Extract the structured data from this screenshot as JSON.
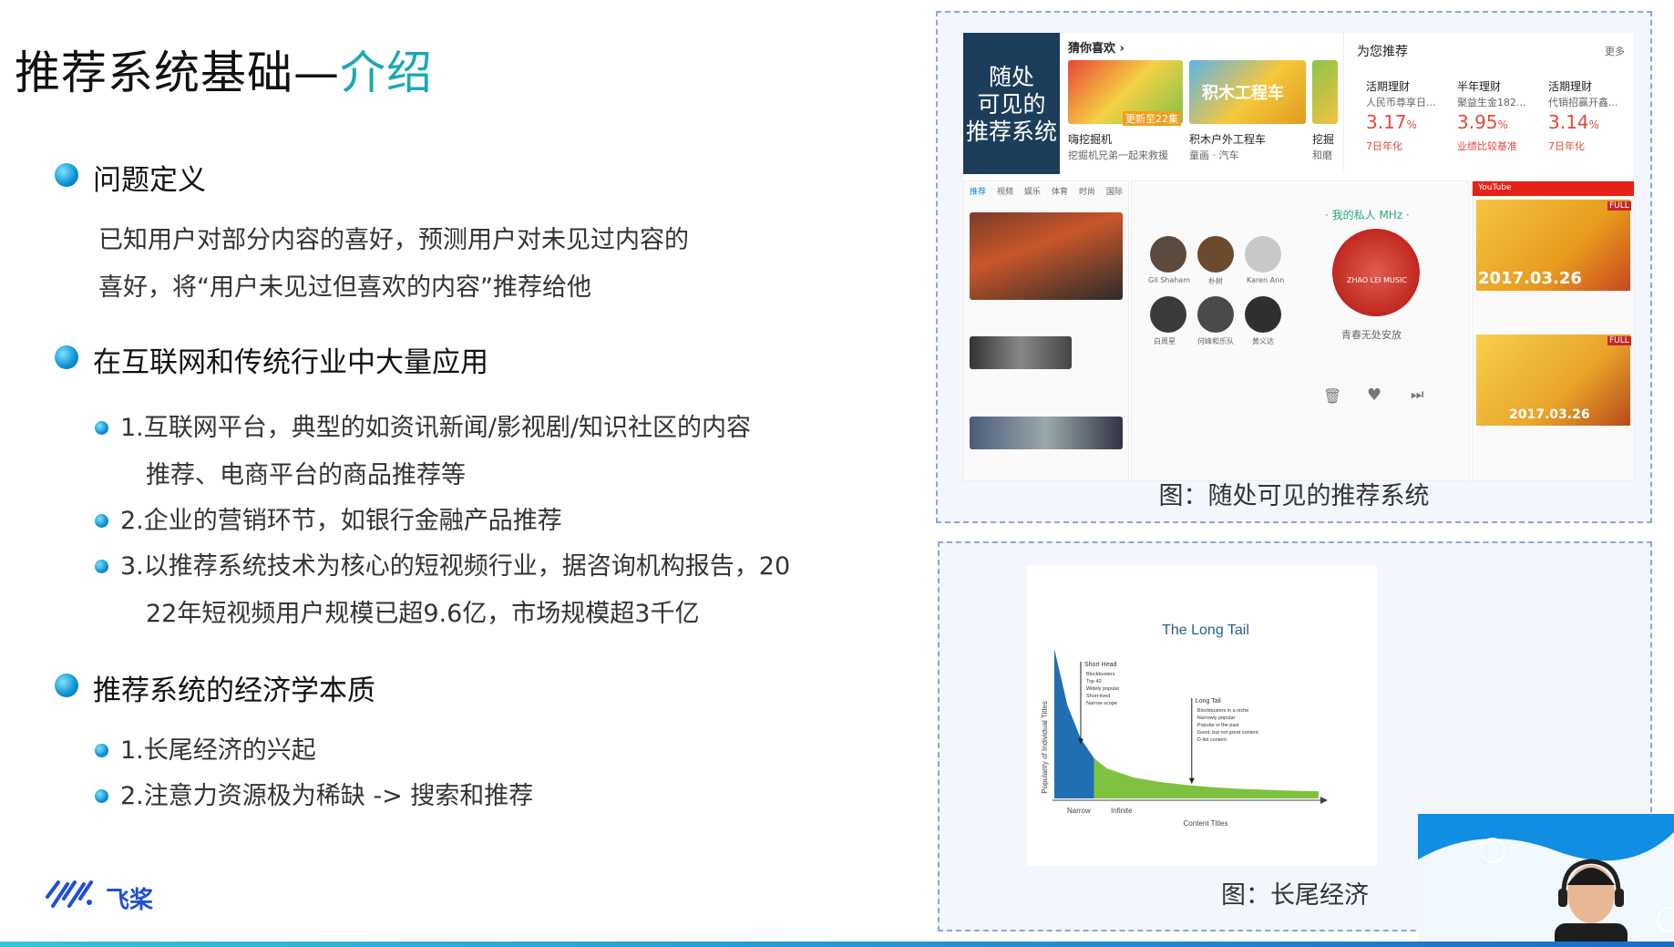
{
  "slide": {
    "title_main": "推荐系统基础—",
    "title_accent": "介绍",
    "sections": [
      {
        "heading": "问题定义",
        "paragraph_lines": [
          "已知用户对部分内容的喜好，预测用户对未见过内容的",
          "喜好，将“用户未见过但喜欢的内容”推荐给他"
        ]
      },
      {
        "heading": "在互联网和传统行业中大量应用",
        "items": [
          {
            "line1": "1.互联网平台，典型的如资讯新闻/影视剧/知识社区的内容",
            "line2": "推荐、电商平台的商品推荐等"
          },
          {
            "line1": "2.企业的营销环节，如银行金融产品推荐"
          },
          {
            "line1": "3.以推荐系统技术为核心的短视频行业，据咨询机构报告，20",
            "line2": "22年短视频用户规模已超9.6亿，市场规模超3千亿"
          }
        ]
      },
      {
        "heading": "推荐系统的经济学本质",
        "items": [
          {
            "line1": "1.长尾经济的兴起"
          },
          {
            "line1": "2.注意力资源极为稀缺 -> 搜索和推荐"
          }
        ]
      }
    ],
    "logo_text": "飞桨"
  },
  "figure1": {
    "caption": "图：随处可见的推荐系统",
    "tag_lines": [
      "随处",
      "可见的",
      "推荐系统"
    ],
    "guess_header": "猜你喜欢 ›",
    "guess_items": [
      {
        "title": "嗨挖掘机",
        "sub": "挖掘机兄弟一起来救援"
      },
      {
        "title": "积木户外工程车",
        "sub": "童画 · 汽车"
      },
      {
        "title": "挖掘",
        "sub": "和磨"
      }
    ],
    "thumb_overlay": "积木工程车",
    "thumb_badge": "更新至22集",
    "finance_header": "为您推荐",
    "finance_more": "更多",
    "finance": [
      {
        "name": "活期理财",
        "desc": "人民币尊享日...",
        "rate": "3.17",
        "unit": "%",
        "note": "7日年化"
      },
      {
        "name": "半年理财",
        "desc": "聚益生金182...",
        "rate": "3.95",
        "unit": "%",
        "note": "业绩比较基准"
      },
      {
        "name": "活期理财",
        "desc": "代销招赢开鑫...",
        "rate": "3.14",
        "unit": "%",
        "note": "7日年化"
      }
    ],
    "news_tabs": [
      "推荐",
      "视频",
      "娱乐",
      "体育",
      "时尚",
      "国际"
    ],
    "music_title": "· 我的私人 MHz ·",
    "music_song": "青春无处安放",
    "music_people": [
      "Gil Shaham",
      "朴树",
      "Karen Ann",
      "白周星",
      "何峰和乐队",
      "黄义达"
    ],
    "disc_label": "ZHAO LEI MUSIC",
    "yt_label": "YouTube",
    "poster_text_1": "2017.03.26",
    "poster_text_2": "2017.03.26",
    "poster_badge": "FULL"
  },
  "figure2": {
    "caption": "图：长尾经济",
    "chart_data": {
      "type": "area",
      "title": "The Long Tail",
      "xlabel": "Content Titles",
      "ylabel": "Popularity of Individual Titles",
      "x_tick_left": "Narrow",
      "x_tick_mid": "Infinite",
      "regions": [
        {
          "name": "Short Head",
          "color": "#1f6fb2",
          "notes": [
            "Blockbusters",
            "Top 40",
            "Widely popular",
            "Short-lived",
            "Narrow scope"
          ]
        },
        {
          "name": "Long Tail",
          "color": "#7fc241",
          "notes": [
            "Blockbusters in a niche",
            "Narrowly popular",
            "Popular in the past",
            "Good, but not great content",
            "D-list content"
          ]
        }
      ],
      "x": [
        0,
        0.05,
        0.1,
        0.15,
        0.2,
        0.3,
        0.4,
        0.5,
        0.6,
        0.7,
        0.8,
        0.9,
        1.0
      ],
      "values": [
        1.0,
        0.62,
        0.4,
        0.27,
        0.2,
        0.14,
        0.11,
        0.09,
        0.075,
        0.065,
        0.058,
        0.052,
        0.048
      ],
      "head_cutoff": 0.15
    }
  }
}
